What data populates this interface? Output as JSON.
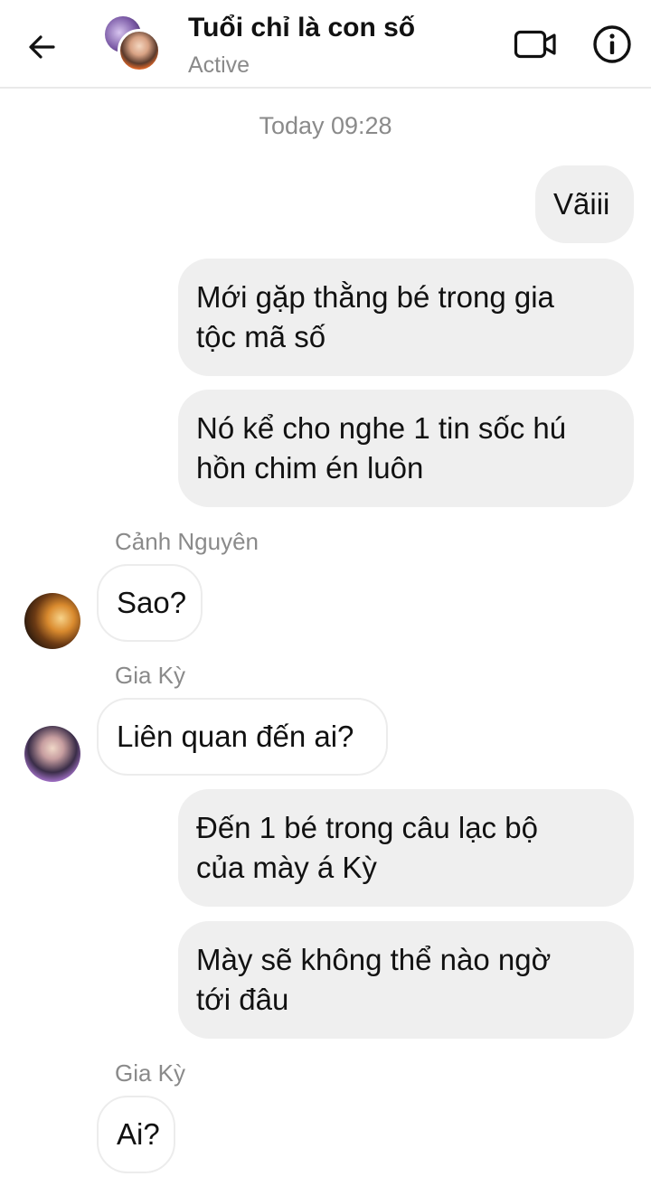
{
  "header": {
    "title": "Tuổi chỉ là con số",
    "status": "Active"
  },
  "timestamp": "Today 09:28",
  "messages": [
    {
      "side": "outgoing",
      "text": "Vãiii"
    },
    {
      "side": "outgoing",
      "line1": "Mới gặp thằng bé trong gia",
      "line2": "tộc mã số"
    },
    {
      "side": "outgoing",
      "line1": "Nó kể cho nghe 1 tin sốc hú",
      "line2": "hồn chim én luôn"
    },
    {
      "side": "incoming",
      "sender": "Cảnh Nguyên",
      "text": "Sao?"
    },
    {
      "side": "incoming",
      "sender": "Gia Kỳ",
      "text": "Liên quan đến ai?"
    },
    {
      "side": "outgoing",
      "line1": "Đến 1 bé trong câu lạc bộ",
      "line2": "của mày á Kỳ"
    },
    {
      "side": "outgoing",
      "line1": "Mày sẽ không thể nào ngờ",
      "line2": "tới đâu"
    },
    {
      "side": "incoming",
      "sender": "Gia Kỳ",
      "text": "Ai?"
    }
  ],
  "colors": {
    "outgoing_bubble": "#efefef",
    "incoming_bubble": "#ffffff",
    "secondary_text": "#8a8a8a"
  },
  "icons": {
    "back": "arrow-left-icon",
    "video": "video-camera-icon",
    "info": "info-icon"
  }
}
